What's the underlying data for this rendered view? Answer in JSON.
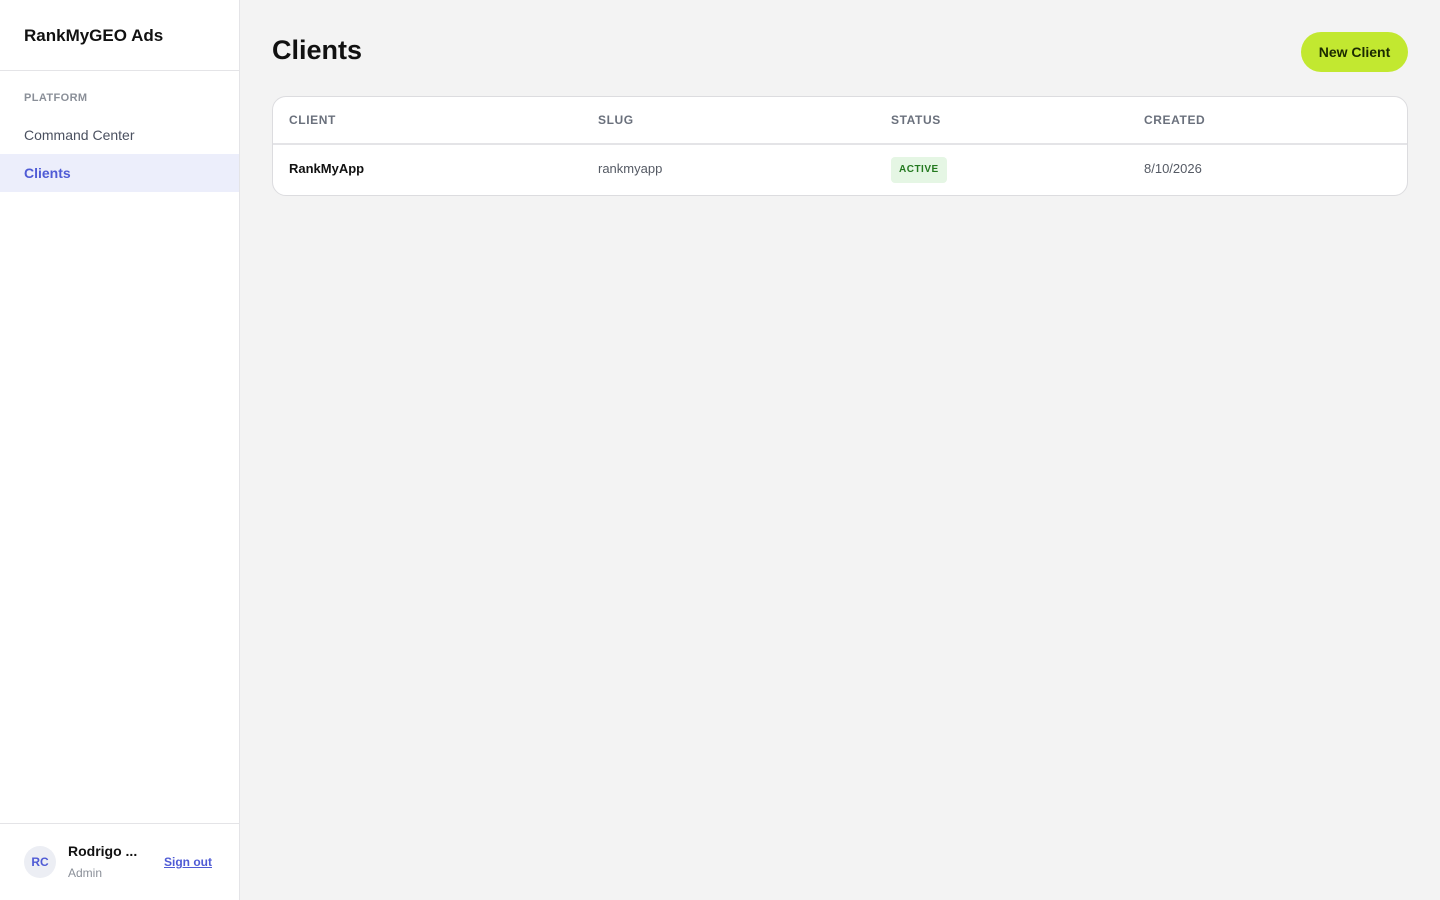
{
  "sidebar": {
    "brand": "RankMyGEO Ads",
    "section_label": "PLATFORM",
    "items": [
      {
        "label": "Command Center"
      },
      {
        "label": "Clients"
      }
    ],
    "active_item": "Clients",
    "user": {
      "initials": "RC",
      "name": "Rodrigo ...",
      "role": "Admin",
      "signout_label": "Sign out"
    }
  },
  "main": {
    "title": "Clients",
    "new_button_label": "New Client",
    "table": {
      "columns": [
        "CLIENT",
        "SLUG",
        "STATUS",
        "CREATED"
      ],
      "rows": [
        {
          "client": "RankMyApp",
          "slug": "rankmyapp",
          "status": "ACTIVE",
          "created": "8/10/2026"
        }
      ]
    }
  },
  "colors": {
    "accent": "#4f5bd5",
    "primary_button": "#c2e830",
    "status_active_bg": "#e5f6e4",
    "status_active_text": "#24791f"
  }
}
